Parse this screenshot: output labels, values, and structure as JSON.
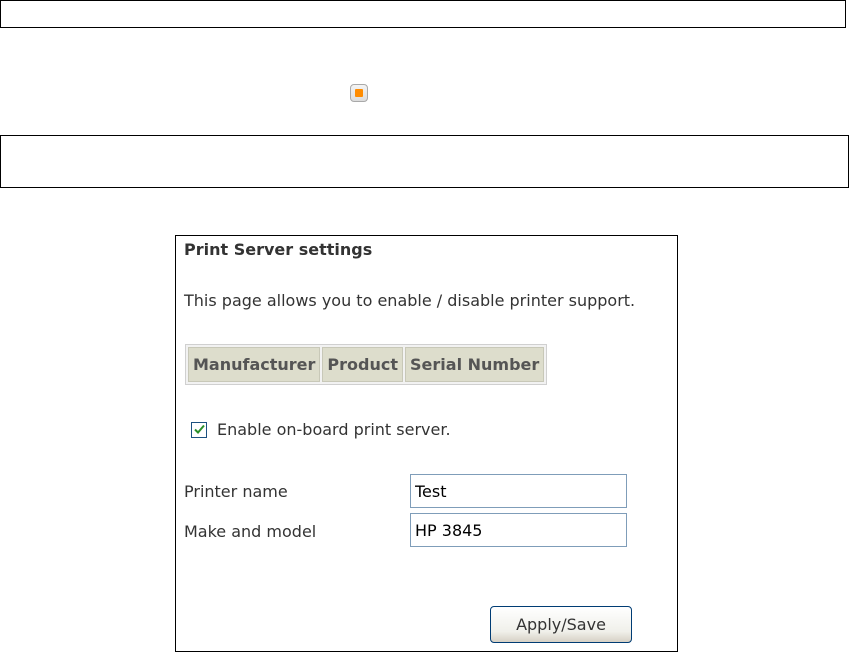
{
  "panel": {
    "title": "Print Server settings",
    "description": "This page allows you to enable / disable printer support.",
    "table": {
      "headers": [
        "Manufacturer",
        "Product",
        "Serial Number"
      ],
      "rows": []
    },
    "enable_checkbox": {
      "label": "Enable on-board print server.",
      "checked": true
    },
    "fields": {
      "printer_name": {
        "label": "Printer name",
        "value": "Test"
      },
      "make_model": {
        "label": "Make and model",
        "value": "HP 3845"
      }
    },
    "apply_button": "Apply/Save"
  },
  "colors": {
    "marker_orange": "#ff8c00",
    "table_header_bg": "#ddddcc",
    "checkbox_check": "#2a8f2a",
    "input_border": "#7f9db9"
  }
}
